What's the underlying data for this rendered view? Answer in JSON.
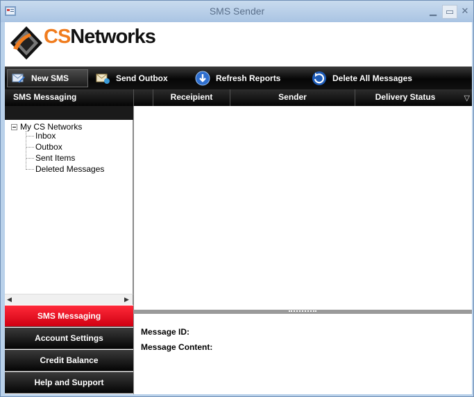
{
  "window": {
    "title": "SMS Sender"
  },
  "logo": {
    "cs": "CS",
    "rest": "Networks"
  },
  "toolbar": {
    "new_sms": "New SMS",
    "send_outbox": "Send Outbox",
    "refresh_reports": "Refresh Reports",
    "delete_all": "Delete All Messages"
  },
  "nav": {
    "header": "SMS Messaging",
    "tree": {
      "root": "My CS Networks",
      "children": [
        "Inbox",
        "Outbox",
        "Sent Items",
        "Deleted Messages"
      ]
    },
    "buttons": [
      "SMS Messaging",
      "Account Settings",
      "Credit Balance",
      "Help and Support"
    ],
    "active_button": "SMS Messaging"
  },
  "grid": {
    "columns": [
      "Receipient",
      "Sender",
      "Delivery Status"
    ]
  },
  "details": {
    "message_id_label": "Message ID:",
    "message_content_label": "Message Content:"
  },
  "colors": {
    "accent_red": "#e0001a",
    "logo_orange": "#f07c1e",
    "toolbar_black": "#0a0a0a"
  },
  "icons": {
    "app": "sms-app-icon",
    "new_sms": "new-sms-icon",
    "send_outbox": "send-outbox-icon",
    "refresh": "download-arrow-icon",
    "delete_all": "delete-refresh-icon"
  }
}
